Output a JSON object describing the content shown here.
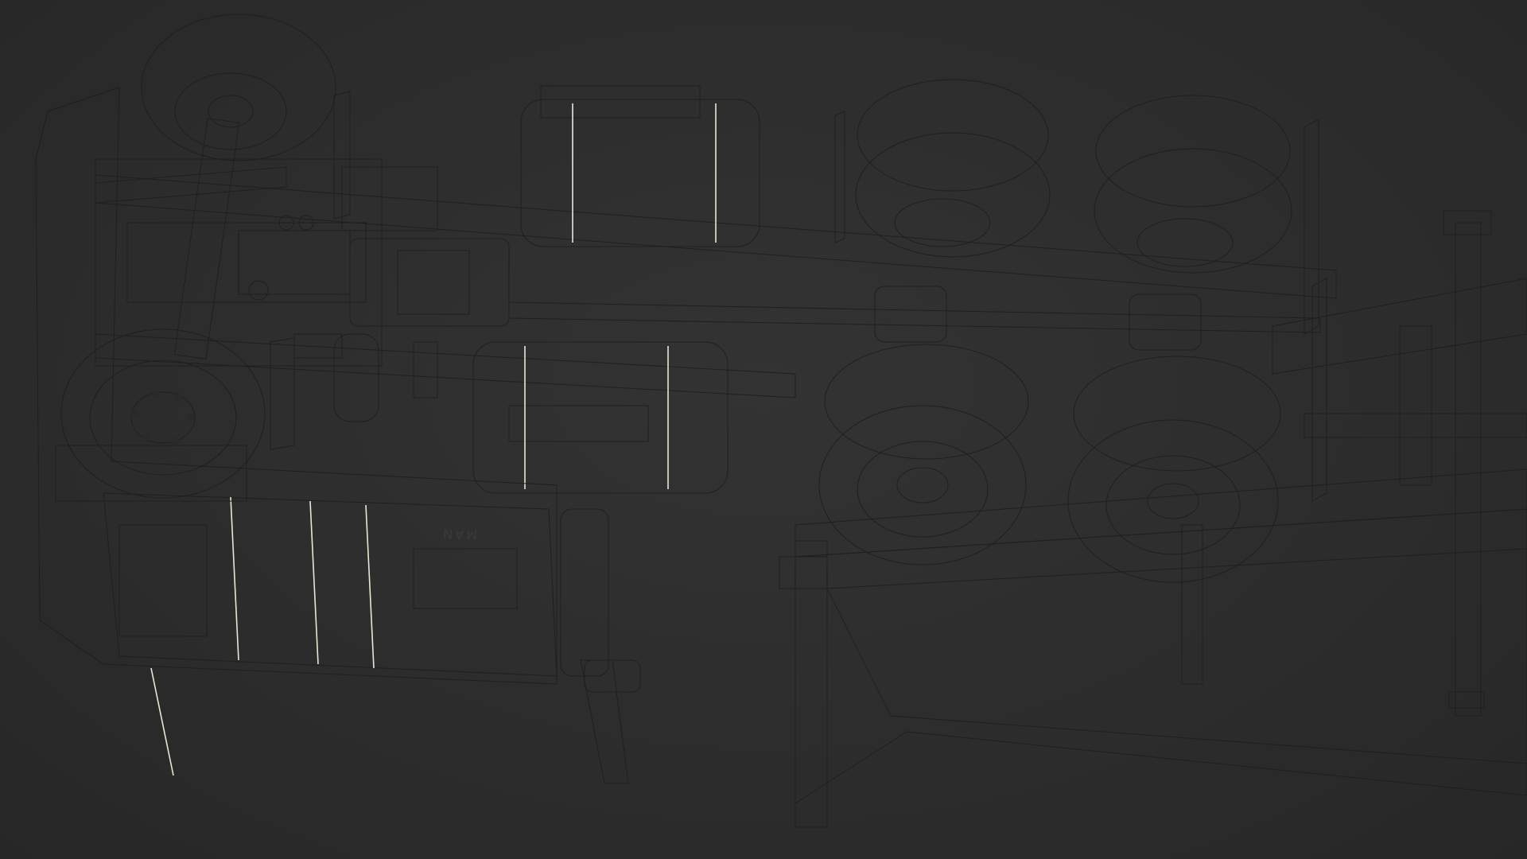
{
  "scene": {
    "subject": "wireframe-truck-underside",
    "cab_brand_text": "MAN",
    "colors": {
      "background": "#2b2b2b",
      "model_fill": "#9a9a8e",
      "model_dark": "#6f6f66",
      "wire": "#e9e7d6"
    }
  }
}
